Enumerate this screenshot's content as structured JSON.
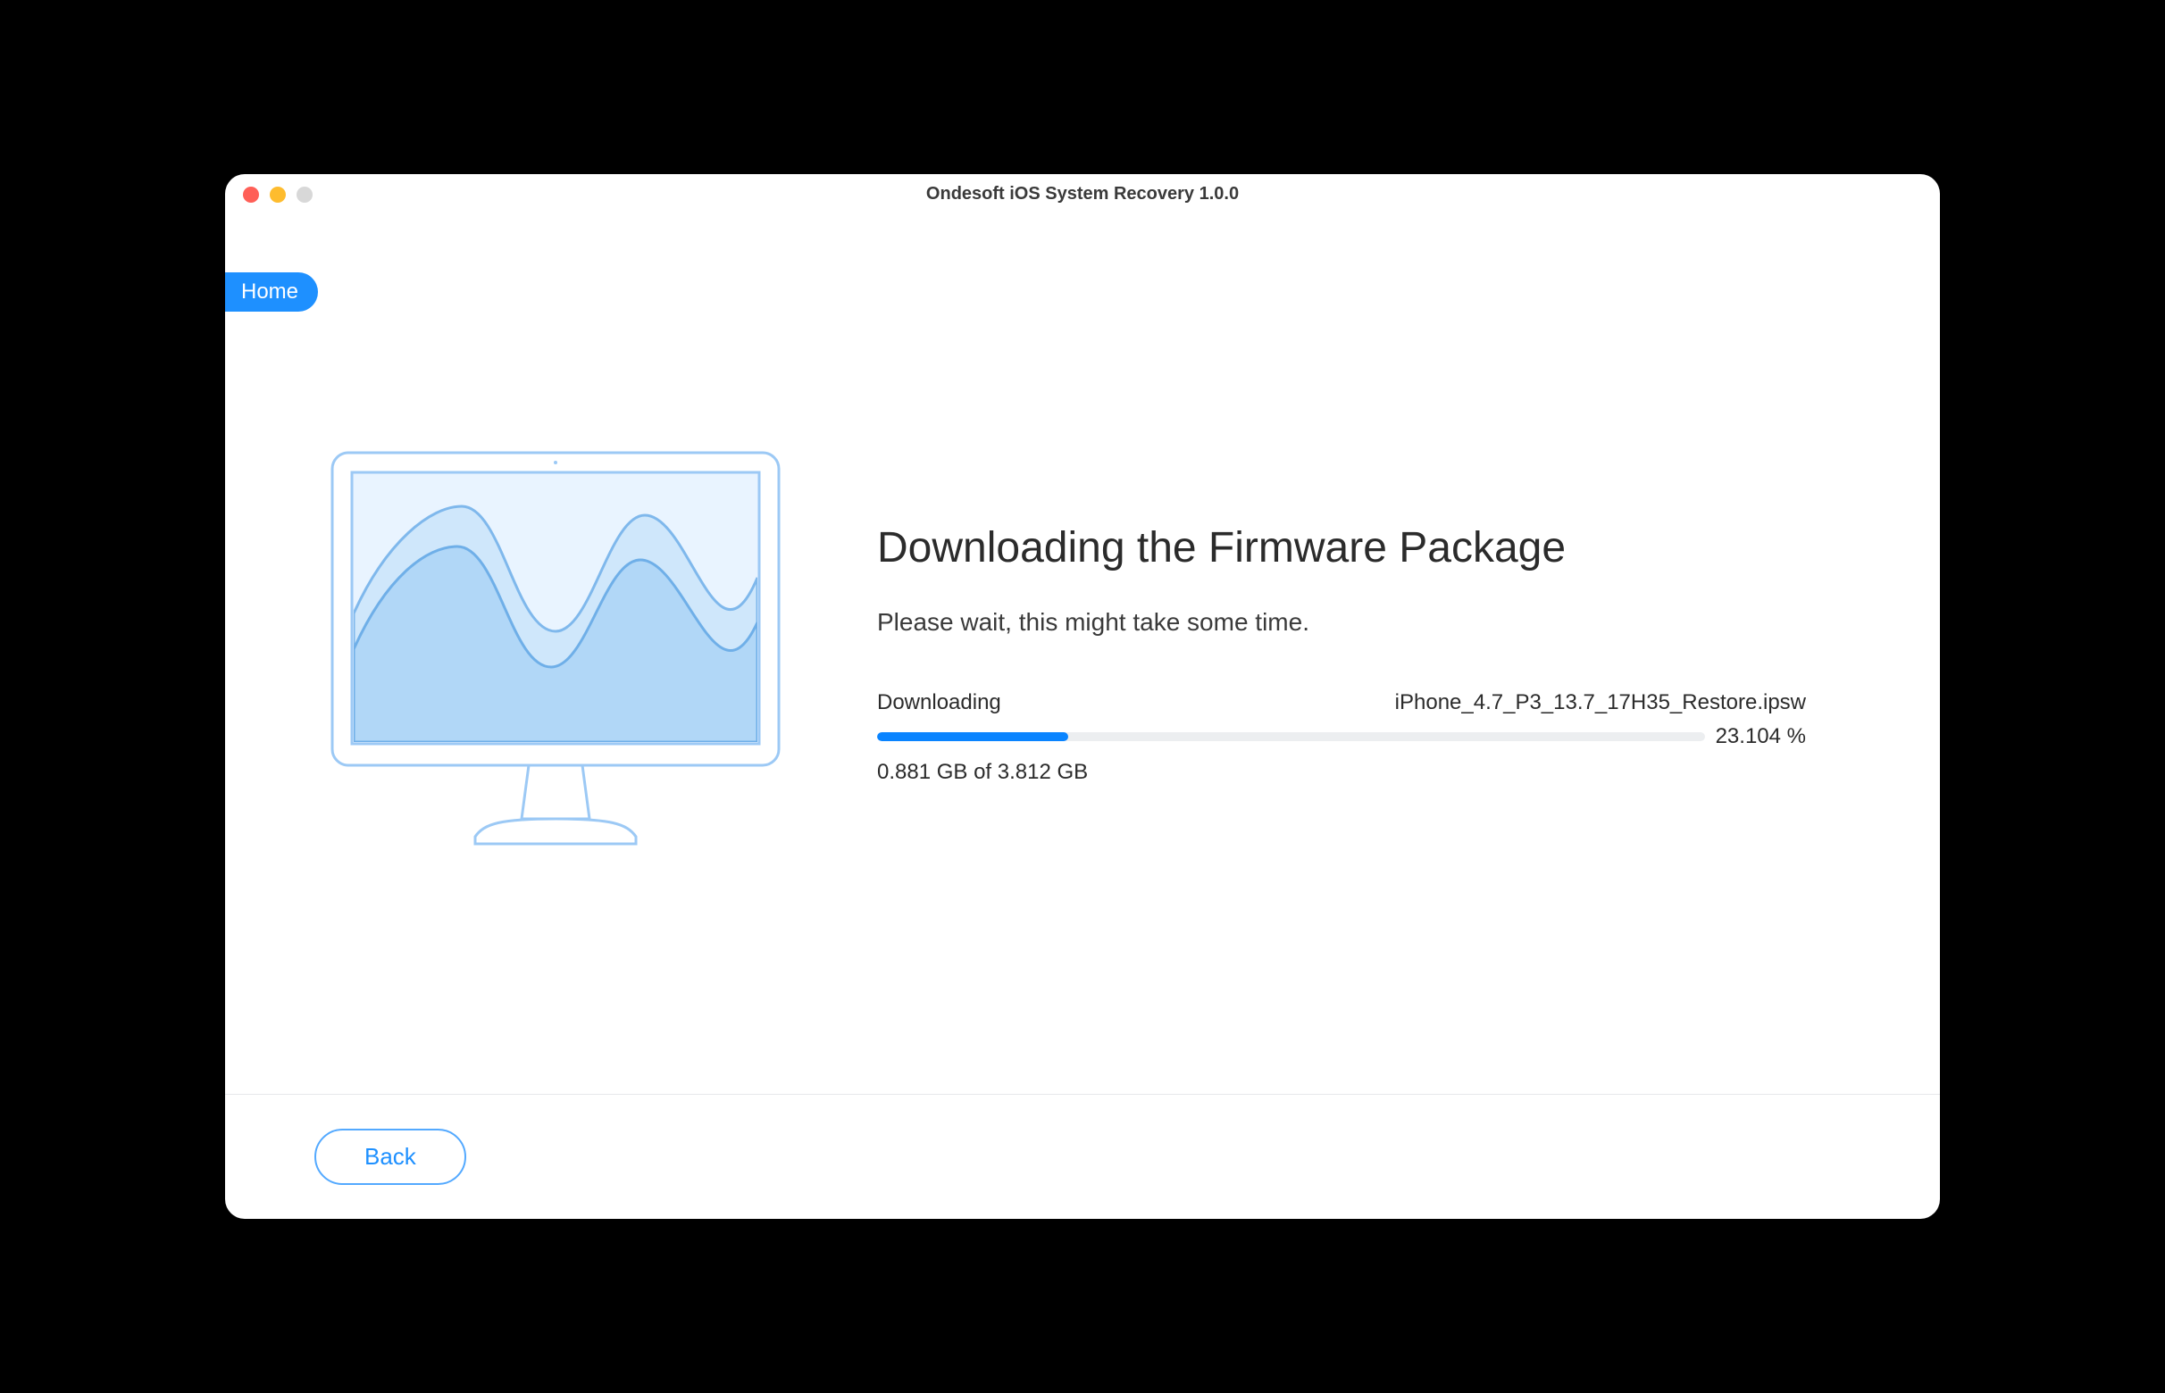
{
  "window": {
    "title": "Ondesoft iOS System Recovery 1.0.0"
  },
  "nav": {
    "home_label": "Home"
  },
  "main": {
    "heading": "Downloading the Firmware Package",
    "subtext": "Please wait, this might take some time.",
    "status_label": "Downloading",
    "filename": "iPhone_4.7_P3_13.7_17H35_Restore.ipsw",
    "percent_text": "23.104 %",
    "percent_value": 23.104,
    "size_text": "0.881 GB of 3.812 GB"
  },
  "footer": {
    "back_label": "Back"
  }
}
